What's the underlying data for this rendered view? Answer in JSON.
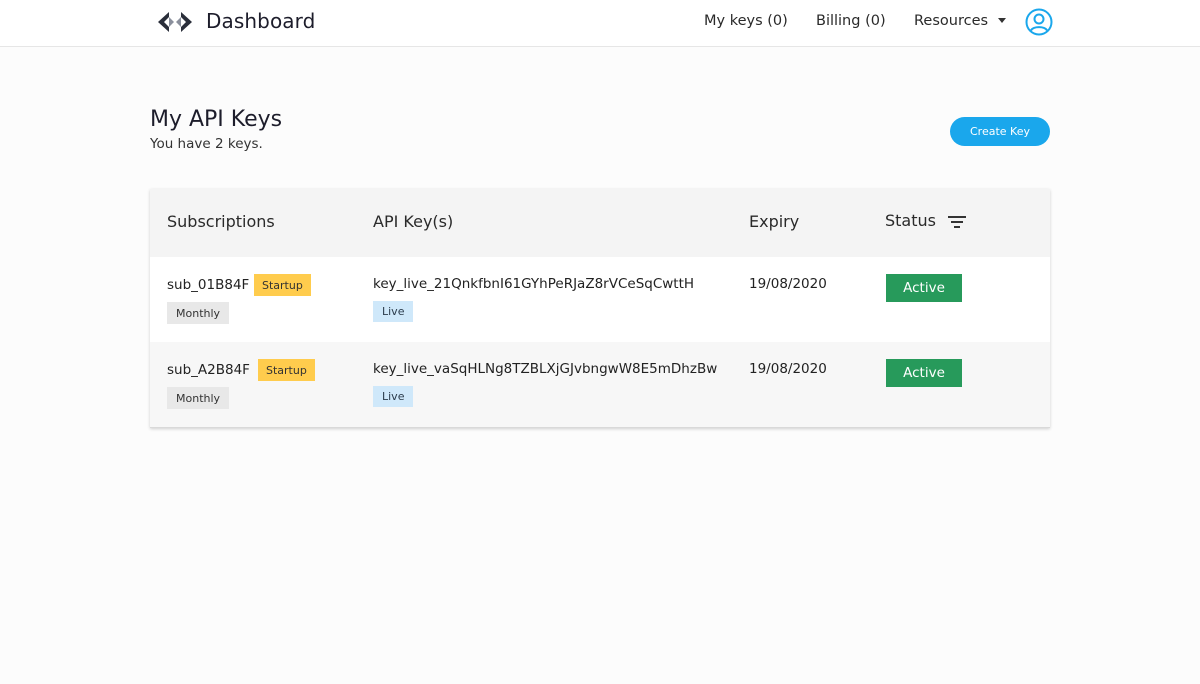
{
  "header": {
    "brand": "Dashboard",
    "nav": {
      "my_keys": "My keys (0)",
      "billing": "Billing (0)",
      "resources": "Resources"
    }
  },
  "page": {
    "title": "My API Keys",
    "subtitle": "You have 2 keys.",
    "create_button": "Create Key"
  },
  "table": {
    "columns": {
      "subscriptions": "Subscriptions",
      "api_keys": "API Key(s)",
      "expiry": "Expiry",
      "status": "Status"
    },
    "rows": [
      {
        "subscription": "sub_01B84F",
        "plan": "Startup",
        "period": "Monthly",
        "key": "key_live_21QnkfbnI61GYhPeRJaZ8rVCeSqCwttH",
        "key_type": "Live",
        "expiry": "19/08/2020",
        "status": "Active"
      },
      {
        "subscription": "sub_A2B84F",
        "plan": "Startup",
        "period": "Monthly",
        "key": "key_live_vaSqHLNg8TZBLXjGJvbngwW8E5mDhzBw",
        "key_type": "Live",
        "expiry": "19/08/2020",
        "status": "Active"
      }
    ]
  },
  "colors": {
    "accent": "#1aa7ec",
    "active": "#279a5b",
    "plan_badge": "#ffcc4d",
    "live_badge": "#cfe8fa"
  },
  "icons": {
    "logo": "brand-logo-icon",
    "user": "user-avatar-icon",
    "filter": "filter-icon",
    "resources": "chevron-down-icon"
  }
}
